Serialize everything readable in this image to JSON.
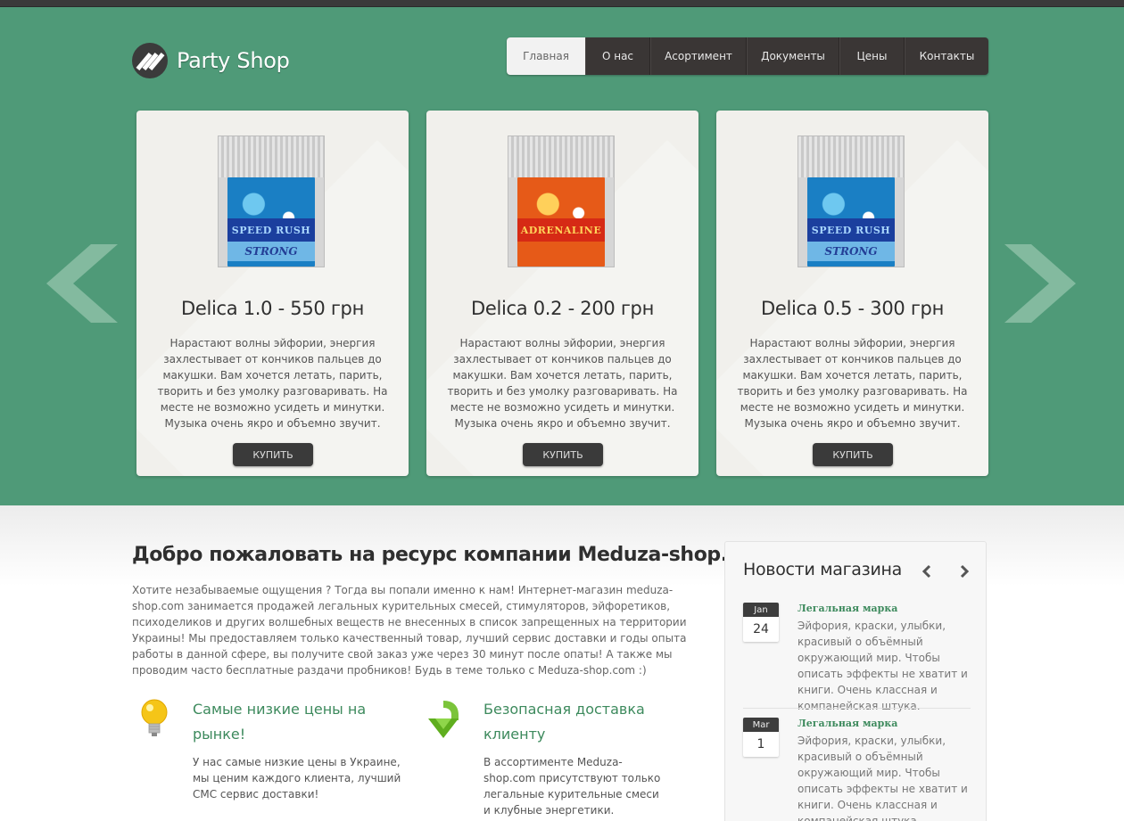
{
  "brand": {
    "name": "Party Shop"
  },
  "nav": {
    "items": [
      {
        "label": "Главная",
        "active": true
      },
      {
        "label": "О нас"
      },
      {
        "label": "Асортимент"
      },
      {
        "label": "Документы"
      },
      {
        "label": "Цены"
      },
      {
        "label": "Контакты"
      }
    ]
  },
  "products": [
    {
      "pack_name": "SPEED RUSH",
      "pack_sub": "STRONG",
      "pack_color": "blue",
      "title": "Delica 1.0 - 550 грн",
      "description": "Нарастают волны эйфории, энергия захлестывает от кончиков пальцев до макушки. Вам хочется летать, парить, творить и без умолку разговаривать. На месте не возможно усидеть и минутки. Музыка очень якро и объемно звучит.",
      "buy_label": "КУПИТЬ"
    },
    {
      "pack_name": "ADRENALINE",
      "pack_sub": "",
      "pack_color": "orange",
      "title": "Delica 0.2 - 200 грн",
      "description": "Нарастают волны эйфории, энергия захлестывает от кончиков пальцев до макушки. Вам хочется летать, парить, творить и без умолку разговаривать. На месте не возможно усидеть и минутки. Музыка очень якро и объемно звучит.",
      "buy_label": "КУПИТЬ"
    },
    {
      "pack_name": "SPEED RUSH",
      "pack_sub": "STRONG",
      "pack_color": "blue",
      "title": "Delica 0.5 - 300 грн",
      "description": "Нарастают волны эйфории, энергия захлестывает от кончиков пальцев до макушки. Вам хочется летать, парить, творить и без умолку разговаривать. На месте не возможно усидеть и минутки. Музыка очень якро и объемно звучит.",
      "buy_label": "КУПИТЬ"
    }
  ],
  "welcome": {
    "title": "Добро пожаловать на ресурс компании Meduza-shop.com",
    "text": "Хотите незабываемые ощущения ? Тогда вы попали именно к нам! Интернет-магазин meduza-shop.com занимается продажей легальных курительных смесей, стимуляторов, эйфоретиков, психоделиков и других волшебных веществ не внесенных в список запрещенных на территории Украины! Мы предоставляем только качественный товар, лучший сервис доставки и годы опыта работы в данной сфере, вы получите свой заказ уже через 30 минут после опаты! А также мы проводим часто бесплатные раздачи пробников! Будь в теме только с Meduza-shop.com :)"
  },
  "features": [
    {
      "icon": "lightbulb-icon",
      "title": "Самые низкие цены на рынке!",
      "text": "У нас самые низкие цены в Украине, мы ценим каждого клиента, лучший СМС сервис доставки!"
    },
    {
      "icon": "down-arrow-icon",
      "title": "Безопасная доставка клиенту",
      "text": "В ассортименте Meduza-shop.com присутствуют только легальные курительные смеси и клубные энергетики."
    }
  ],
  "news": {
    "title": "Новости магазина",
    "items": [
      {
        "month": "Jan",
        "day": "24",
        "headline": "Легальная марка",
        "text": "Эйфория, краски, улыбки, красивый о объёмный окружающий мир. Чтобы описать эффекты не хватит и книги. Очень классная и компанейская штука."
      },
      {
        "month": "Mar",
        "day": "1",
        "headline": "Легальная марка",
        "text": "Эйфория, краски, улыбки, красивый о объёмный окружающий мир. Чтобы описать эффекты не хватит и книги. Очень классная и компанейская штука."
      }
    ]
  },
  "colors": {
    "hero_bg": "#4f9a78",
    "accent_green": "#3d8a5d",
    "dark": "#3a3635"
  }
}
